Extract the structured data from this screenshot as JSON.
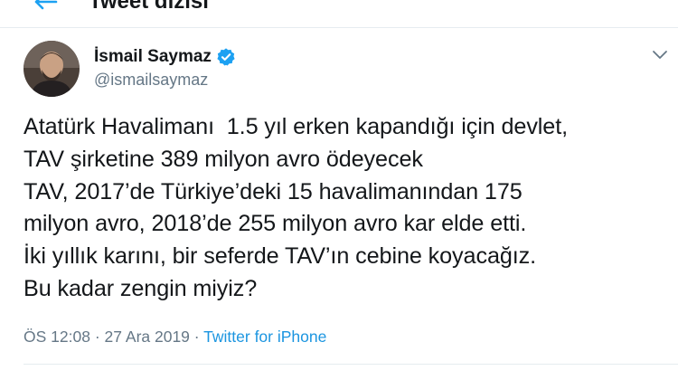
{
  "header": {
    "title": "Tweet dizisi"
  },
  "tweet": {
    "author": {
      "name": "İsmail Saymaz",
      "handle": "@ismailsaymaz",
      "verified": true
    },
    "lines": [
      "Atatürk Havalimanı  1.5 yıl erken kapandığı için devlet,",
      "TAV şirketine 389 milyon avro ödeyecek",
      "TAV, 2017’de Türkiye’deki 15 havalimanından 175",
      "milyon avro, 2018’de 255 milyon avro kar elde etti.",
      "İki yıllık karını, bir seferde TAV’ın cebine koyacağız.",
      "Bu kadar zengin miyiz?"
    ],
    "time": "ÖS 12:08",
    "separator": "·",
    "date": "27 Ara 2019",
    "source": "Twitter for iPhone"
  },
  "colors": {
    "accent": "#1da1f2",
    "link": "#1b95e0",
    "secondary_text": "#657786",
    "divider": "#e6ecf0"
  },
  "icons": {
    "back": "back-arrow-icon",
    "verified": "verified-badge-icon",
    "more": "chevron-down-icon"
  }
}
